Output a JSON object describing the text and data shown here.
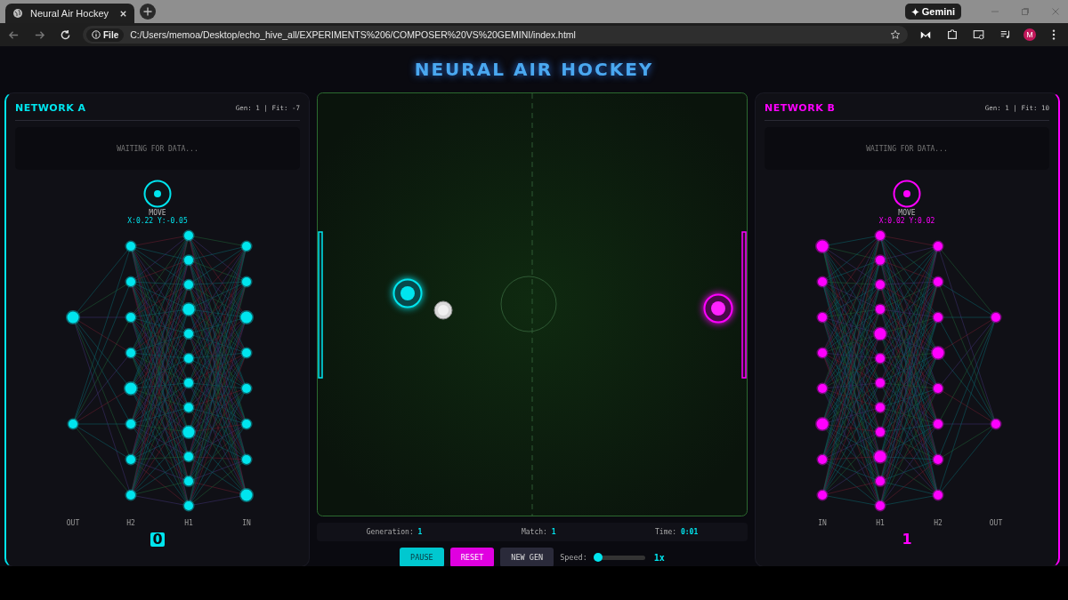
{
  "browser": {
    "tab_title": "Neural Air Hockey",
    "gemini": "Gemini",
    "file_chip": "File",
    "url": "C:/Users/memoa/Desktop/echo_hive_all/EXPERIMENTS%206/COMPOSER%20VS%20GEMINI/index.html",
    "avatar": "M"
  },
  "title": "NEURAL AIR HOCKEY",
  "networks": [
    {
      "name": "NETWORK A",
      "stats": "Gen: 1 | Fit: -7",
      "status": "WAITING FOR DATA...",
      "output_label": "MOVE",
      "output_value": "X:0.22 Y:-0.05",
      "color": "#00e5ee",
      "score": "0",
      "highlighted": true,
      "layers": [
        {
          "label": "OUT",
          "kind": "output"
        },
        {
          "label": "H2",
          "kind": "hidden"
        },
        {
          "label": "H1",
          "kind": "wide"
        },
        {
          "label": "IN",
          "kind": "input"
        }
      ]
    },
    {
      "name": "NETWORK B",
      "stats": "Gen: 1 | Fit: 10",
      "status": "WAITING FOR DATA...",
      "output_label": "MOVE",
      "output_value": "X:0.02 Y:0.02",
      "color": "#ff00ff",
      "score": "1",
      "highlighted": false,
      "layers": [
        {
          "label": "IN",
          "kind": "input"
        },
        {
          "label": "H1",
          "kind": "wide"
        },
        {
          "label": "H2",
          "kind": "hidden"
        },
        {
          "label": "OUT",
          "kind": "output"
        }
      ]
    }
  ],
  "stats": [
    {
      "label": "Generation:",
      "value": "1"
    },
    {
      "label": "Match:",
      "value": "1"
    },
    {
      "label": "Time:",
      "value": "0:01"
    }
  ],
  "controls": {
    "buttons": [
      {
        "label": "PAUSE",
        "kind": "pause"
      },
      {
        "label": "RESET",
        "kind": "reset"
      },
      {
        "label": "NEW GEN",
        "kind": "plain"
      }
    ],
    "speed": {
      "label": "Speed:",
      "level": 0,
      "reading": "1x"
    }
  }
}
